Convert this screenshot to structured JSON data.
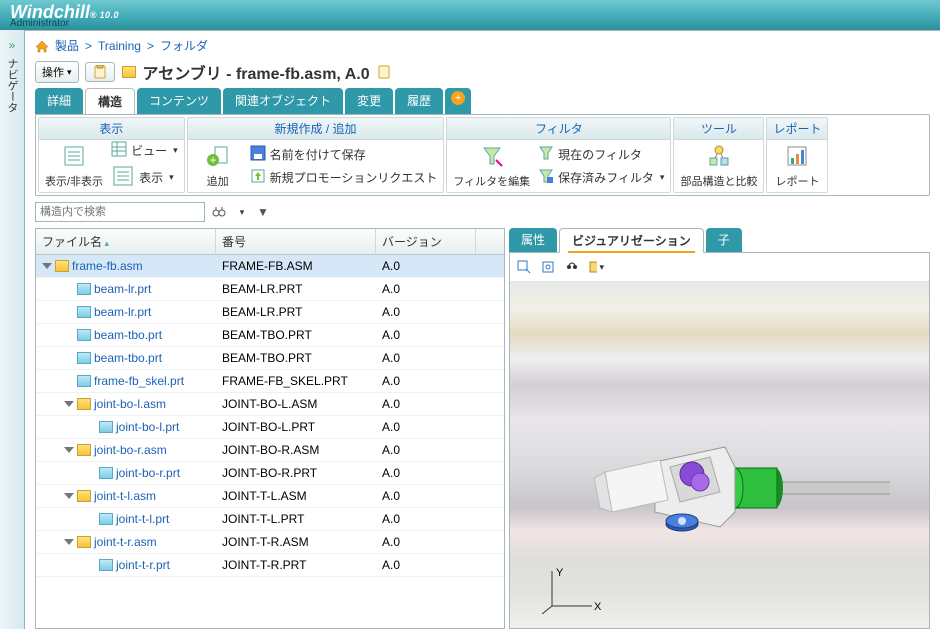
{
  "brand": {
    "name": "Windchill",
    "reg": "®",
    "version": "10.0"
  },
  "admin_label": "Administrator",
  "sidebar_label": "ナビゲータ",
  "breadcrumb": {
    "items": [
      "製品",
      "Training",
      "フォルダ"
    ]
  },
  "titlebar": {
    "actions_label": "操作",
    "object_type": "アセンブリ",
    "object_name": "frame-fb.asm, A.0"
  },
  "tabs": {
    "items": [
      "詳細",
      "構造",
      "コンテンツ",
      "関連オブジェクト",
      "変更",
      "履歴"
    ],
    "active_index": 1
  },
  "ribbon": {
    "groups": [
      {
        "title": "表示",
        "big_buttons": [
          {
            "label": "表示/非表示",
            "icon": "form-icon"
          }
        ],
        "small_buttons": [
          {
            "label": "ビュー",
            "icon": "grid-icon",
            "dropdown": true
          },
          {
            "label": "表示",
            "icon": "form-icon",
            "dropdown": true
          }
        ]
      },
      {
        "title": "新規作成 / 追加",
        "big_buttons": [
          {
            "label": "追加",
            "icon": "add-icon"
          }
        ],
        "small_buttons": [
          {
            "label": "名前を付けて保存",
            "icon": "saveas-icon"
          },
          {
            "label": "新規プロモーションリクエスト",
            "icon": "promo-icon"
          }
        ]
      },
      {
        "title": "フィルタ",
        "big_buttons": [
          {
            "label": "フィルタを編集",
            "icon": "filter-edit-icon"
          }
        ],
        "small_buttons": [
          {
            "label": "現在のフィルタ",
            "icon": "filter-now-icon"
          },
          {
            "label": "保存済みフィルタ",
            "icon": "filter-saved-icon",
            "dropdown": true
          }
        ]
      },
      {
        "title": "ツール",
        "big_buttons": [
          {
            "label": "部品構造と比較",
            "icon": "compare-icon"
          }
        ]
      },
      {
        "title": "レポート",
        "big_buttons": [
          {
            "label": "レポート",
            "icon": "report-icon"
          }
        ]
      }
    ]
  },
  "search": {
    "placeholder": "構造内で検索"
  },
  "tree": {
    "columns": {
      "name": "ファイル名",
      "number": "番号",
      "version": "バージョン"
    },
    "rows": [
      {
        "indent": 0,
        "exp": true,
        "asm": true,
        "name": "frame-fb.asm",
        "num": "FRAME-FB.ASM",
        "ver": "A.0",
        "selected": true
      },
      {
        "indent": 1,
        "asm": false,
        "name": "beam-lr.prt",
        "num": "BEAM-LR.PRT",
        "ver": "A.0"
      },
      {
        "indent": 1,
        "asm": false,
        "name": "beam-lr.prt",
        "num": "BEAM-LR.PRT",
        "ver": "A.0"
      },
      {
        "indent": 1,
        "asm": false,
        "name": "beam-tbo.prt",
        "num": "BEAM-TBO.PRT",
        "ver": "A.0"
      },
      {
        "indent": 1,
        "asm": false,
        "name": "beam-tbo.prt",
        "num": "BEAM-TBO.PRT",
        "ver": "A.0"
      },
      {
        "indent": 1,
        "asm": false,
        "name": "frame-fb_skel.prt",
        "num": "FRAME-FB_SKEL.PRT",
        "ver": "A.0"
      },
      {
        "indent": 1,
        "exp": true,
        "asm": true,
        "name": "joint-bo-l.asm",
        "num": "JOINT-BO-L.ASM",
        "ver": "A.0"
      },
      {
        "indent": 2,
        "asm": false,
        "name": "joint-bo-l.prt",
        "num": "JOINT-BO-L.PRT",
        "ver": "A.0"
      },
      {
        "indent": 1,
        "exp": true,
        "asm": true,
        "name": "joint-bo-r.asm",
        "num": "JOINT-BO-R.ASM",
        "ver": "A.0"
      },
      {
        "indent": 2,
        "asm": false,
        "name": "joint-bo-r.prt",
        "num": "JOINT-BO-R.PRT",
        "ver": "A.0"
      },
      {
        "indent": 1,
        "exp": true,
        "asm": true,
        "name": "joint-t-l.asm",
        "num": "JOINT-T-L.ASM",
        "ver": "A.0"
      },
      {
        "indent": 2,
        "asm": false,
        "name": "joint-t-l.prt",
        "num": "JOINT-T-L.PRT",
        "ver": "A.0"
      },
      {
        "indent": 1,
        "exp": true,
        "asm": true,
        "name": "joint-t-r.asm",
        "num": "JOINT-T-R.ASM",
        "ver": "A.0"
      },
      {
        "indent": 2,
        "asm": false,
        "name": "joint-t-r.prt",
        "num": "JOINT-T-R.PRT",
        "ver": "A.0"
      }
    ]
  },
  "viz": {
    "tabs": [
      "属性",
      "ビジュアリゼーション",
      "子"
    ],
    "active_index": 1,
    "axis": {
      "x": "X",
      "y": "Y"
    }
  }
}
